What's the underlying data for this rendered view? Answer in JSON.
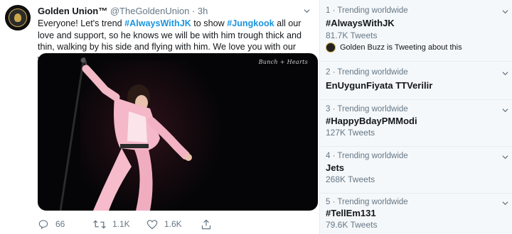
{
  "tweet": {
    "author_name": "Golden Union™",
    "handle": "@TheGoldenUnion",
    "separator": "·",
    "time": "3h",
    "text_parts": {
      "p1": "Everyone! Let's trend ",
      "tag1": "#AlwaysWithJK",
      "p2": " to show ",
      "tag2": "#Jungkook",
      "p3": " all our love and support, so he knows we will be with him trough thick and thin, walking by his side and flying with him. We love you with our whole hearts Kookie"
    },
    "media_watermark": "Bunch + Hearts",
    "actions": {
      "replies": "66",
      "retweets": "1.1K",
      "likes": "1.6K"
    }
  },
  "trends": [
    {
      "meta": "1 · Trending worldwide",
      "title": "#AlwaysWithJK",
      "count": "81.7K Tweets",
      "buzz": "Golden Buzz is Tweeting about this"
    },
    {
      "meta": "2 · Trending worldwide",
      "title": "EnUygunFiyata TTVerilir",
      "count": ""
    },
    {
      "meta": "3 · Trending worldwide",
      "title": "#HappyBdayPMModi",
      "count": "127K Tweets"
    },
    {
      "meta": "4 · Trending worldwide",
      "title": "Jets",
      "count": "268K Tweets"
    },
    {
      "meta": "5 · Trending worldwide",
      "title": "#TellEm131",
      "count": "79.6K Tweets"
    }
  ],
  "icons": {
    "reply": "reply-icon",
    "retweet": "retweet-icon",
    "like": "heart-icon",
    "share": "share-icon",
    "caret": "chevron-down-icon"
  },
  "colors": {
    "link": "#1b95e0",
    "muted": "#657786",
    "trends_bg": "#f5f8fa",
    "emoji_heart": "#a77fd1"
  }
}
